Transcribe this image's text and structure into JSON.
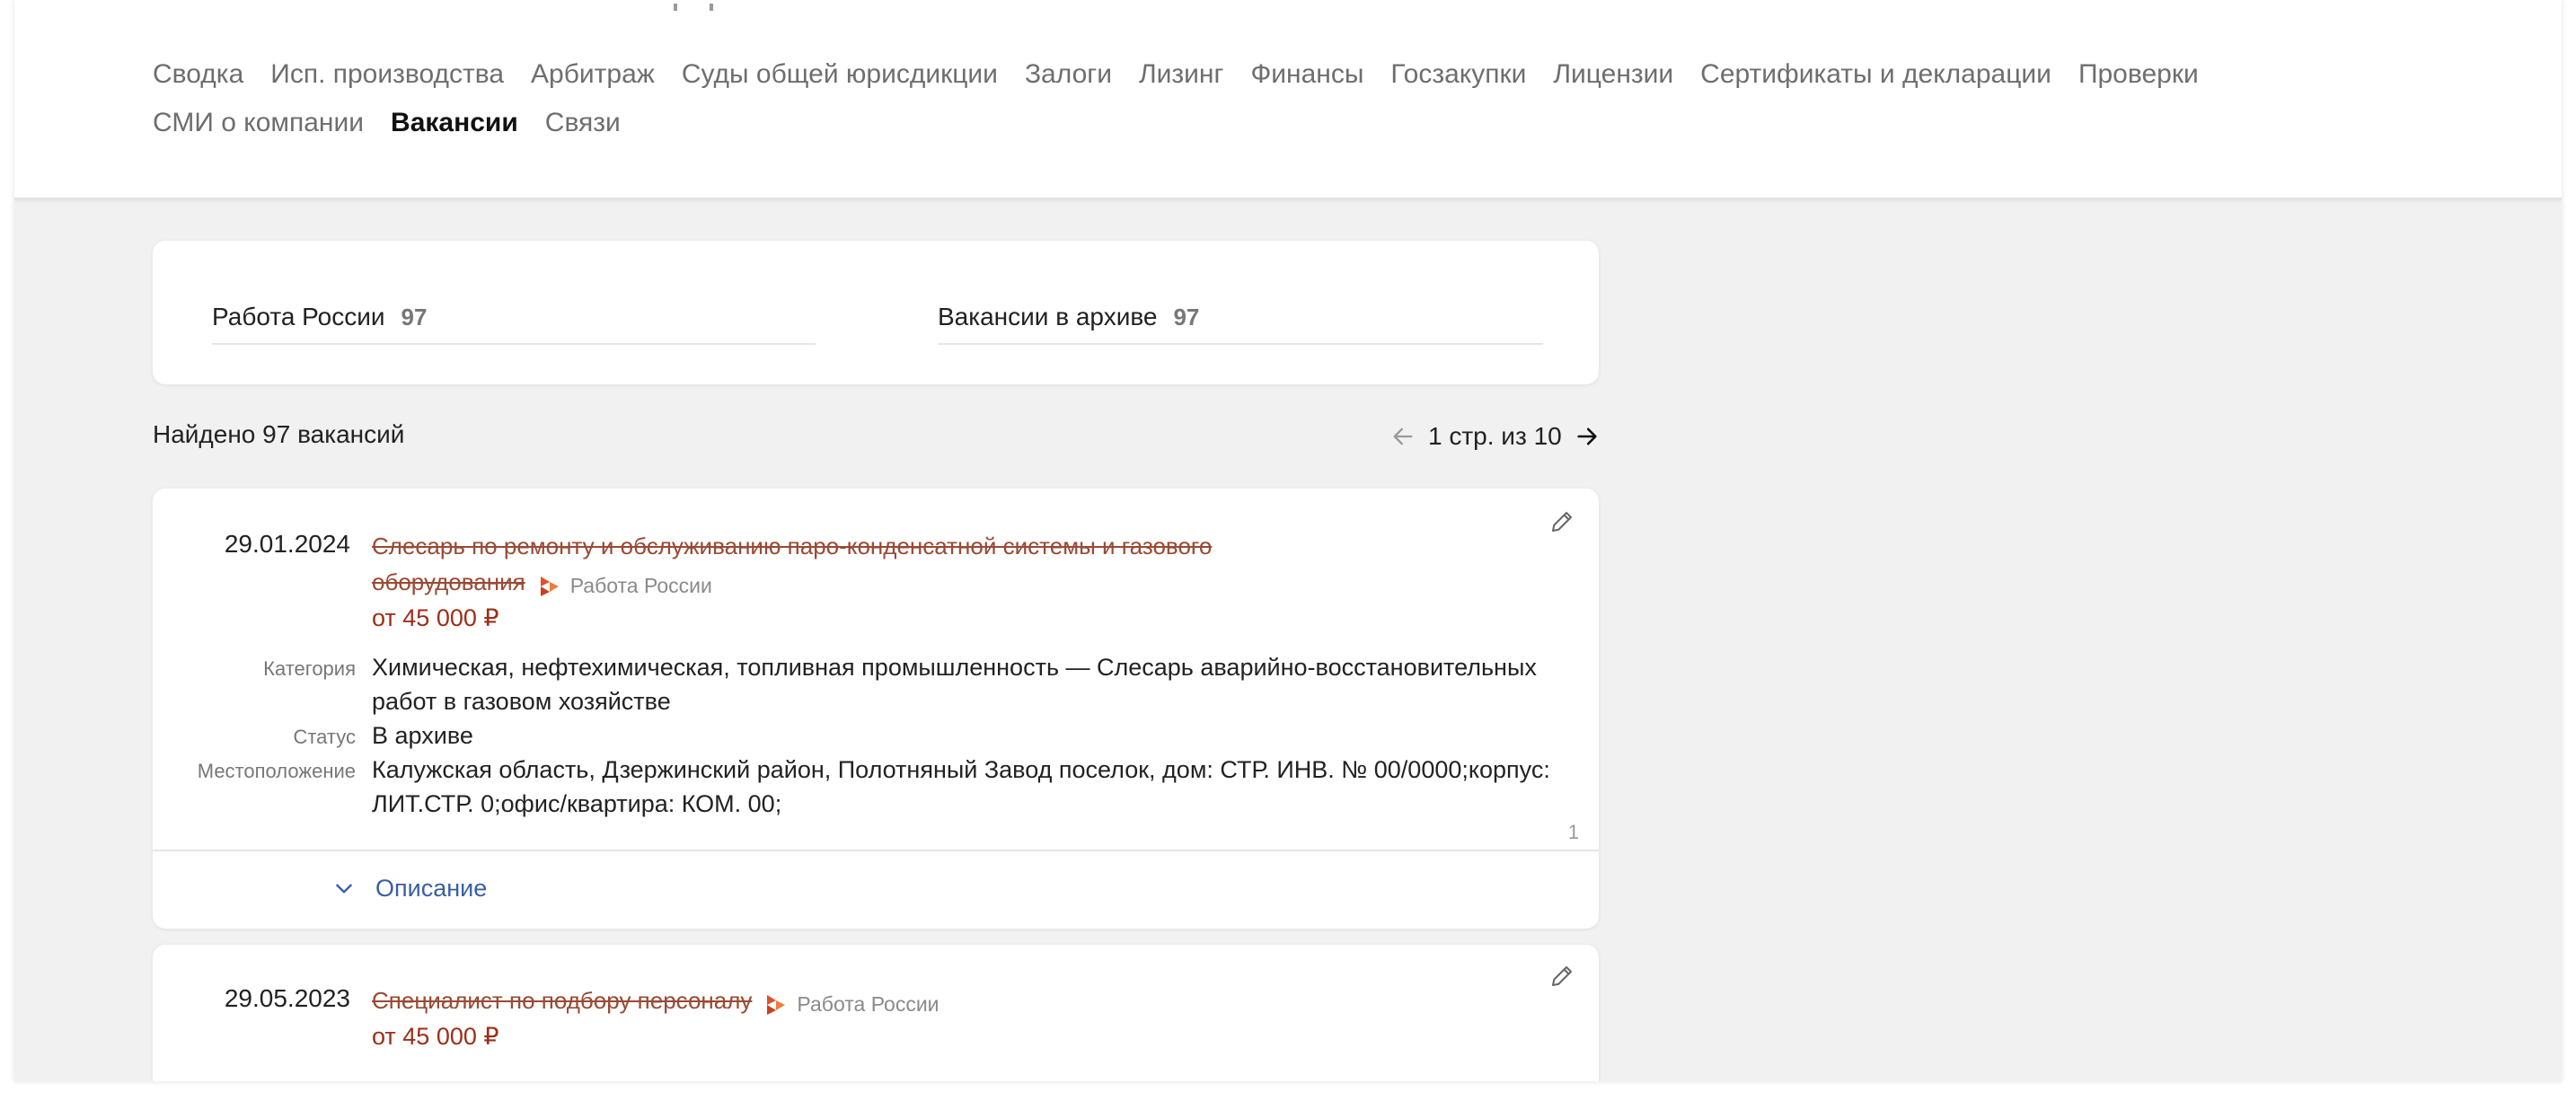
{
  "nav": {
    "row1": [
      "Сводка",
      "Исп. производства",
      "Арбитраж",
      "Суды общей юрисдикции",
      "Залоги",
      "Лизинг",
      "Финансы",
      "Госзакупки",
      "Лицензии",
      "Сертификаты и декларации",
      "Проверки"
    ],
    "row2": [
      "СМИ о компании",
      "Вакансии",
      "Связи"
    ],
    "active": "Вакансии"
  },
  "sources": [
    {
      "label": "Работа России",
      "count": "97"
    },
    {
      "label": "Вакансии в архиве",
      "count": "97"
    }
  ],
  "found_text": "Найдено 97 вакансий",
  "pager_text": "1 стр. из 10",
  "vacancies": [
    {
      "date": "29.01.2024",
      "title": "Слесарь по ремонту и обслуживанию паро-конденсатной системы и газового оборудования",
      "source": "Работа России",
      "salary": "от 45 000 ₽",
      "category_label": "Категория",
      "category": "Химическая, нефтехимическая, топливная промышленность — Слесарь аварийно-восстановительных работ в газовом хозяйстве",
      "status_label": "Статус",
      "status": "В архиве",
      "location_label": "Местоположение",
      "location": "Калужская область, Дзержинский район, Полотняный Завод поселок, дом: СТР. ИНВ. № 00/0000;корпус: ЛИТ.СТР. 0;офис/квартира: КОМ. 00;",
      "index": "1",
      "description_label": "Описание"
    },
    {
      "date": "29.05.2023",
      "title": "Специалист по подбору персоналу",
      "source": "Работа России",
      "salary": "от 45 000 ₽"
    }
  ],
  "colors": {
    "accent_link": "#3a5ea8",
    "archived_title": "#9a4a34",
    "salary": "#9c2f18",
    "source_logo": "#e0522c"
  }
}
